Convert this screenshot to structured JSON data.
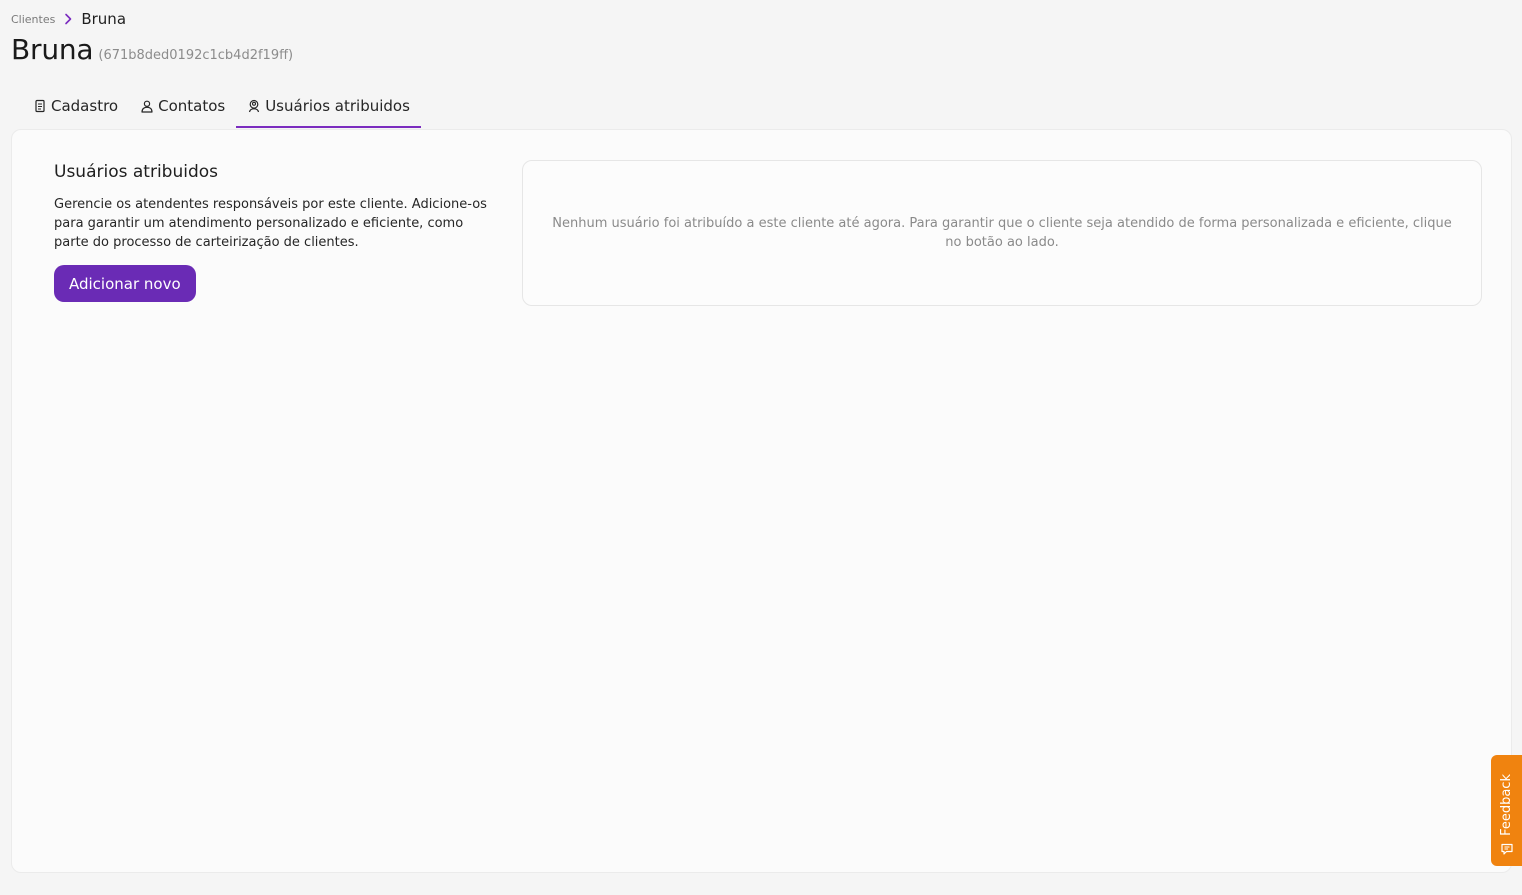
{
  "breadcrumb": {
    "parent": "Clientes",
    "current": "Bruna",
    "separator_icon": "chevron-right-icon"
  },
  "header": {
    "title": "Bruna",
    "id": "(671b8ded0192c1cb4d2f19ff)"
  },
  "tabs": [
    {
      "label": "Cadastro",
      "icon": "document-icon",
      "active": false
    },
    {
      "label": "Contatos",
      "icon": "user-icon",
      "active": false
    },
    {
      "label": "Usuários atribuidos",
      "icon": "user-circle-icon",
      "active": true
    }
  ],
  "assigned_users": {
    "title": "Usuários atribuidos",
    "description": "Gerencie os atendentes responsáveis por este cliente. Adicione-os para garantir um atendimento personalizado e eficiente, como parte do processo de carteirização de clientes.",
    "add_button": "Adicionar novo",
    "empty_message": "Nenhum usuário foi atribuído a este cliente até agora. Para garantir que o cliente seja atendido de forma personalizada e eficiente, clique no botão ao lado."
  },
  "feedback": {
    "label": "Feedback",
    "icon": "chat-icon"
  },
  "colors": {
    "accent": "#7b2cbf",
    "button": "#6a2bb5",
    "feedback": "#f0830f"
  }
}
